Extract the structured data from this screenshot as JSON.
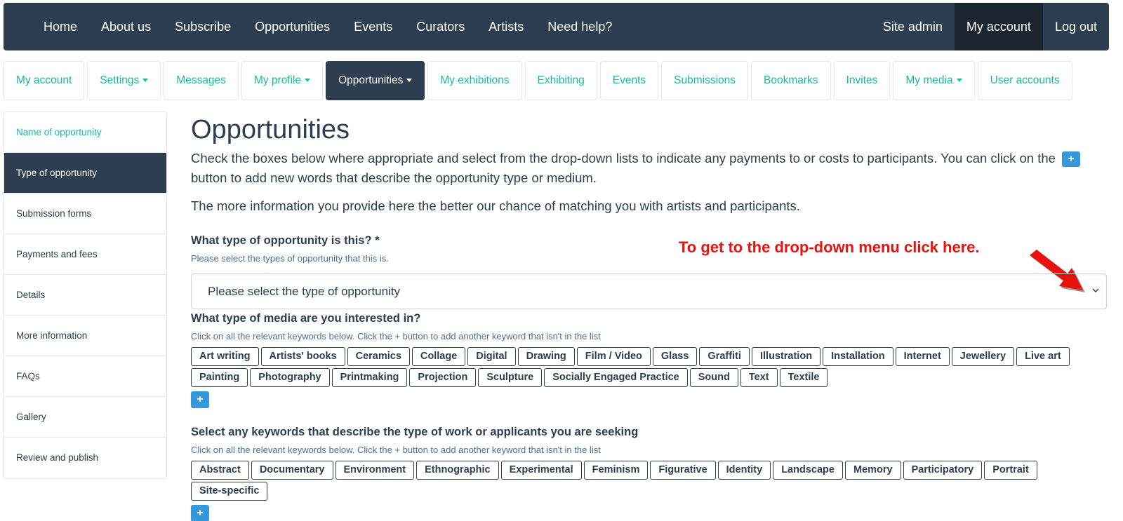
{
  "topnav": {
    "left_items": [
      "Home",
      "About us",
      "Subscribe",
      "Opportunities",
      "Events",
      "Curators",
      "Artists",
      "Need help?"
    ],
    "right_items": [
      "Site admin",
      "My account",
      "Log out"
    ]
  },
  "subtabs": [
    {
      "label": "My account",
      "dropdown": false
    },
    {
      "label": "Settings",
      "dropdown": true
    },
    {
      "label": "Messages",
      "dropdown": false
    },
    {
      "label": "My profile",
      "dropdown": true
    },
    {
      "label": "Opportunities",
      "dropdown": true
    },
    {
      "label": "My exhibitions",
      "dropdown": false
    },
    {
      "label": "Exhibiting",
      "dropdown": false
    },
    {
      "label": "Events",
      "dropdown": false
    },
    {
      "label": "Submissions",
      "dropdown": false
    },
    {
      "label": "Bookmarks",
      "dropdown": false
    },
    {
      "label": "Invites",
      "dropdown": false
    },
    {
      "label": "My media",
      "dropdown": true
    },
    {
      "label": "User accounts",
      "dropdown": false
    }
  ],
  "sidebar": {
    "items": [
      "Name of opportunity",
      "Type of opportunity",
      "Submission forms",
      "Payments and fees",
      "Details",
      "More information",
      "FAQs",
      "Gallery",
      "Review and publish"
    ]
  },
  "main": {
    "title": "Opportunities",
    "intro_part1": "Check the boxes below where appropriate and select from the drop-down lists to indicate any payments to or costs to participants. You can click on the",
    "intro_part2": "button to add new words that describe the opportunity type or medium.",
    "intro2": "The more information you provide here the better our chance of matching you with artists and participants.",
    "plus_symbol": "+",
    "type_question": "What type of opportunity is this? *",
    "type_help": "Please select the types of opportunity that this is.",
    "type_select_value": "Please select the type of opportunity",
    "annotation": "To get to the drop-down menu click here.",
    "media_question": "What type of media are you interested in?",
    "media_help": "Click on all the relevant keywords below. Click the + button to add another keyword that isn't in the list",
    "media_tags": [
      "Art writing",
      "Artists' books",
      "Ceramics",
      "Collage",
      "Digital",
      "Drawing",
      "Film / Video",
      "Glass",
      "Graffiti",
      "Illustration",
      "Installation",
      "Internet",
      "Jewellery",
      "Live art",
      "Painting",
      "Photography",
      "Printmaking",
      "Projection",
      "Sculpture",
      "Socially Engaged Practice",
      "Sound",
      "Text",
      "Textile"
    ],
    "keywords_question": "Select any keywords that describe the type of work or applicants you are seeking",
    "keywords_help": "Click on all the relevant keywords below. Click the + button to add another keyword that isn't in the list",
    "keyword_tags": [
      "Abstract",
      "Documentary",
      "Environment",
      "Ethnographic",
      "Experimental",
      "Feminism",
      "Figurative",
      "Identity",
      "Landscape",
      "Memory",
      "Participatory",
      "Portrait",
      "Site-specific"
    ]
  },
  "colors": {
    "navbar": "#2c3e50",
    "accent_link": "#18bc9c",
    "plus_button": "#3498db",
    "annotation": "#e8120c"
  }
}
